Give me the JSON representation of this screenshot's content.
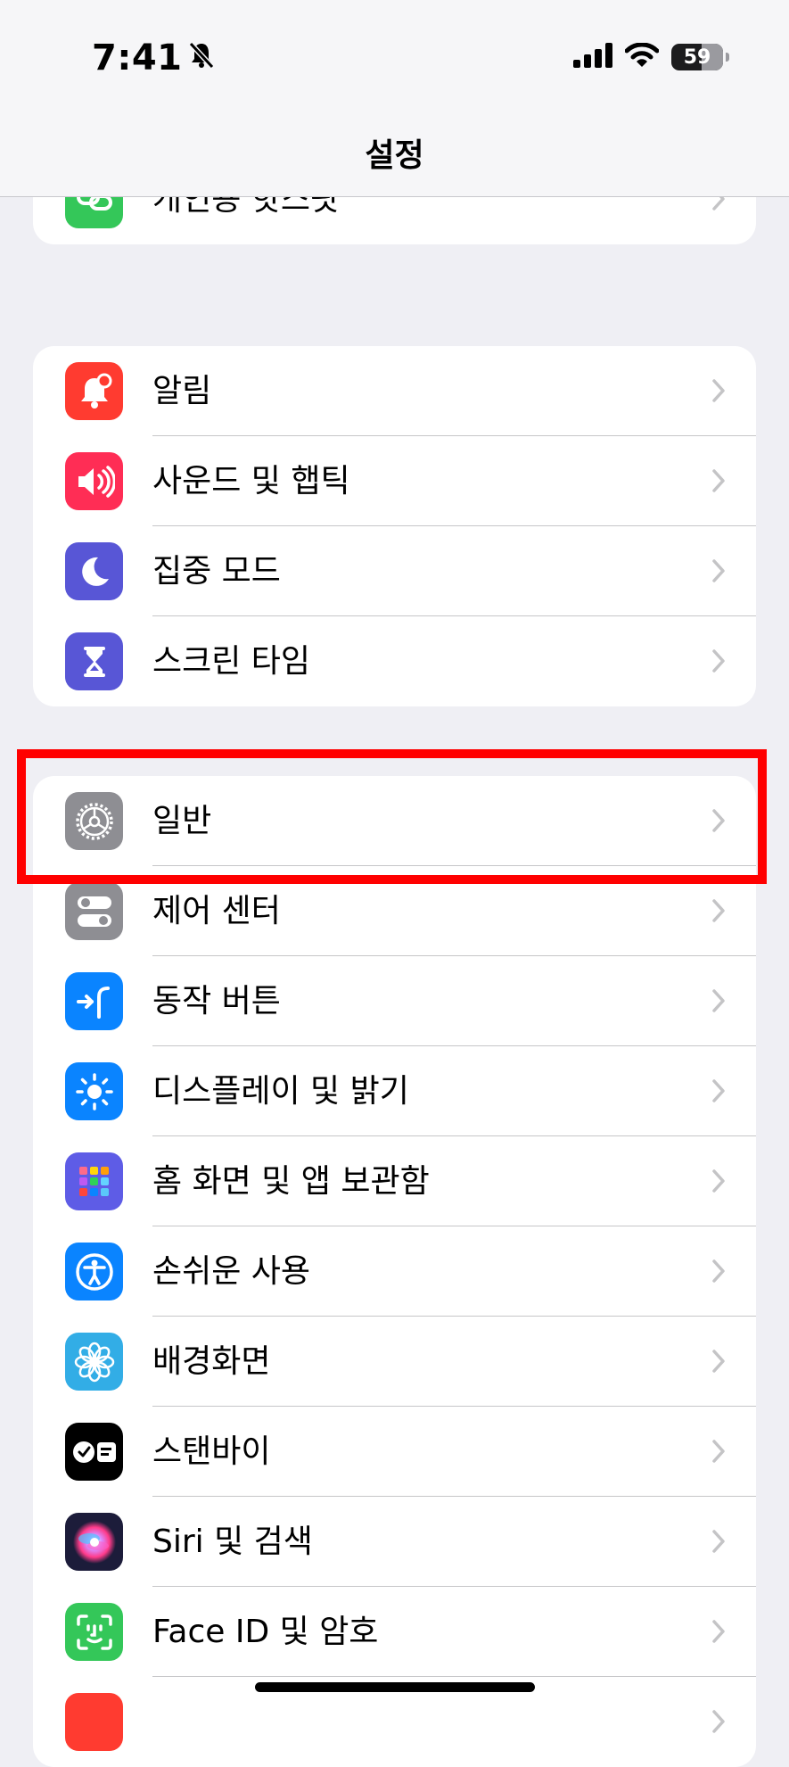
{
  "status_bar": {
    "time": "7:41",
    "battery": "59",
    "battery_percent": 59
  },
  "nav": {
    "title": "설정"
  },
  "groups": [
    {
      "items": [
        {
          "label": "개인용 핫스팟",
          "icon": "personal-hotspot-icon",
          "color": "#34c759"
        }
      ]
    },
    {
      "items": [
        {
          "label": "알림",
          "icon": "notifications-icon",
          "color": "#ff3b30"
        },
        {
          "label": "사운드 및 햅틱",
          "icon": "sound-icon",
          "color": "#ff2d55"
        },
        {
          "label": "집중 모드",
          "icon": "focus-moon-icon",
          "color": "#5856d6"
        },
        {
          "label": "스크린 타임",
          "icon": "hourglass-icon",
          "color": "#5856d6"
        }
      ]
    },
    {
      "items": [
        {
          "label": "일반",
          "icon": "gear-icon",
          "color": "#8e8e93"
        },
        {
          "label": "제어 센터",
          "icon": "control-center-icon",
          "color": "#8e8e93"
        },
        {
          "label": "동작 버튼",
          "icon": "action-button-icon",
          "color": "#0a84ff"
        },
        {
          "label": "디스플레이 및 밝기",
          "icon": "brightness-icon",
          "color": "#0a84ff"
        },
        {
          "label": "홈 화면 및 앱 보관함",
          "icon": "home-screen-grid-icon",
          "color": "#5e5ce6"
        },
        {
          "label": "손쉬운 사용",
          "icon": "accessibility-icon",
          "color": "#0a84ff"
        },
        {
          "label": "배경화면",
          "icon": "wallpaper-flower-icon",
          "color": "#32ade6"
        },
        {
          "label": "스탠바이",
          "icon": "standby-icon",
          "color": "#000000"
        },
        {
          "label": "Siri 및 검색",
          "icon": "siri-icon",
          "color": "#1c1c3a"
        },
        {
          "label": "Face ID 및 암호",
          "icon": "face-id-icon",
          "color": "#34c759"
        },
        {
          "label": "",
          "icon": "emergency-sos-icon",
          "color": "#ff3b30"
        }
      ]
    }
  ]
}
